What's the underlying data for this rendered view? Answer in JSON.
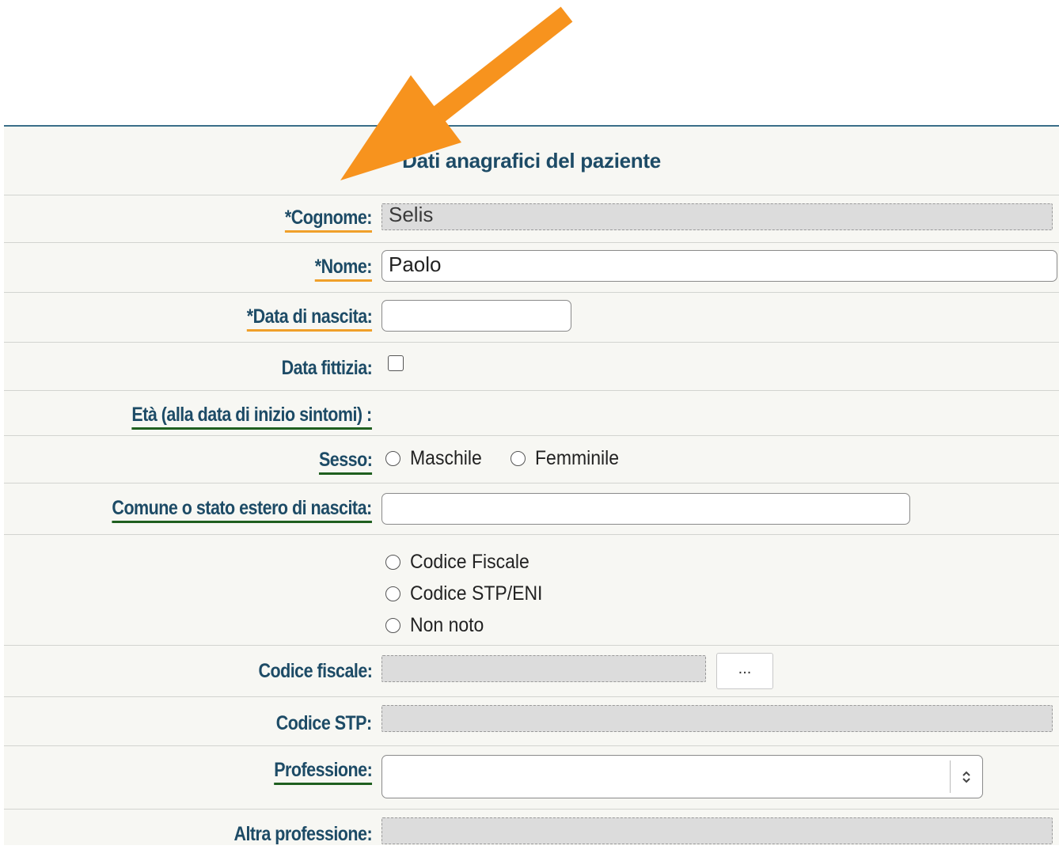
{
  "form": {
    "title": "Dati anagrafici del paziente",
    "cognome": {
      "label": "*Cognome:",
      "value": "Selis"
    },
    "nome": {
      "label": "*Nome:",
      "value": "Paolo"
    },
    "data_nascita": {
      "label": "*Data di nascita:",
      "value": ""
    },
    "data_fittizia": {
      "label": "Data fittizia:",
      "checked": false
    },
    "eta": {
      "label": "Età (alla data di inizio sintomi) :"
    },
    "sesso": {
      "label": "Sesso:",
      "options": [
        "Maschile",
        "Femminile"
      ]
    },
    "comune": {
      "label": "Comune o stato estero di nascita:",
      "value": ""
    },
    "codice_tipo": {
      "options": [
        "Codice Fiscale",
        "Codice STP/ENI",
        "Non noto"
      ]
    },
    "codice_fiscale": {
      "label": "Codice fiscale:",
      "value": "",
      "button_label": "..."
    },
    "codice_stp": {
      "label": "Codice STP:",
      "value": ""
    },
    "professione": {
      "label": "Professione:",
      "value": ""
    },
    "altra_professione": {
      "label": "Altra professione:",
      "value": ""
    }
  },
  "colors": {
    "label_text": "#1d4b66",
    "required_underline": "#f0a02a",
    "optional_underline": "#1f5f1f",
    "annotation_arrow": "#f7931e",
    "panel_background": "#f7f7f3"
  },
  "icons": {
    "annotation": "arrow-icon",
    "select": "select-updown-icon"
  }
}
